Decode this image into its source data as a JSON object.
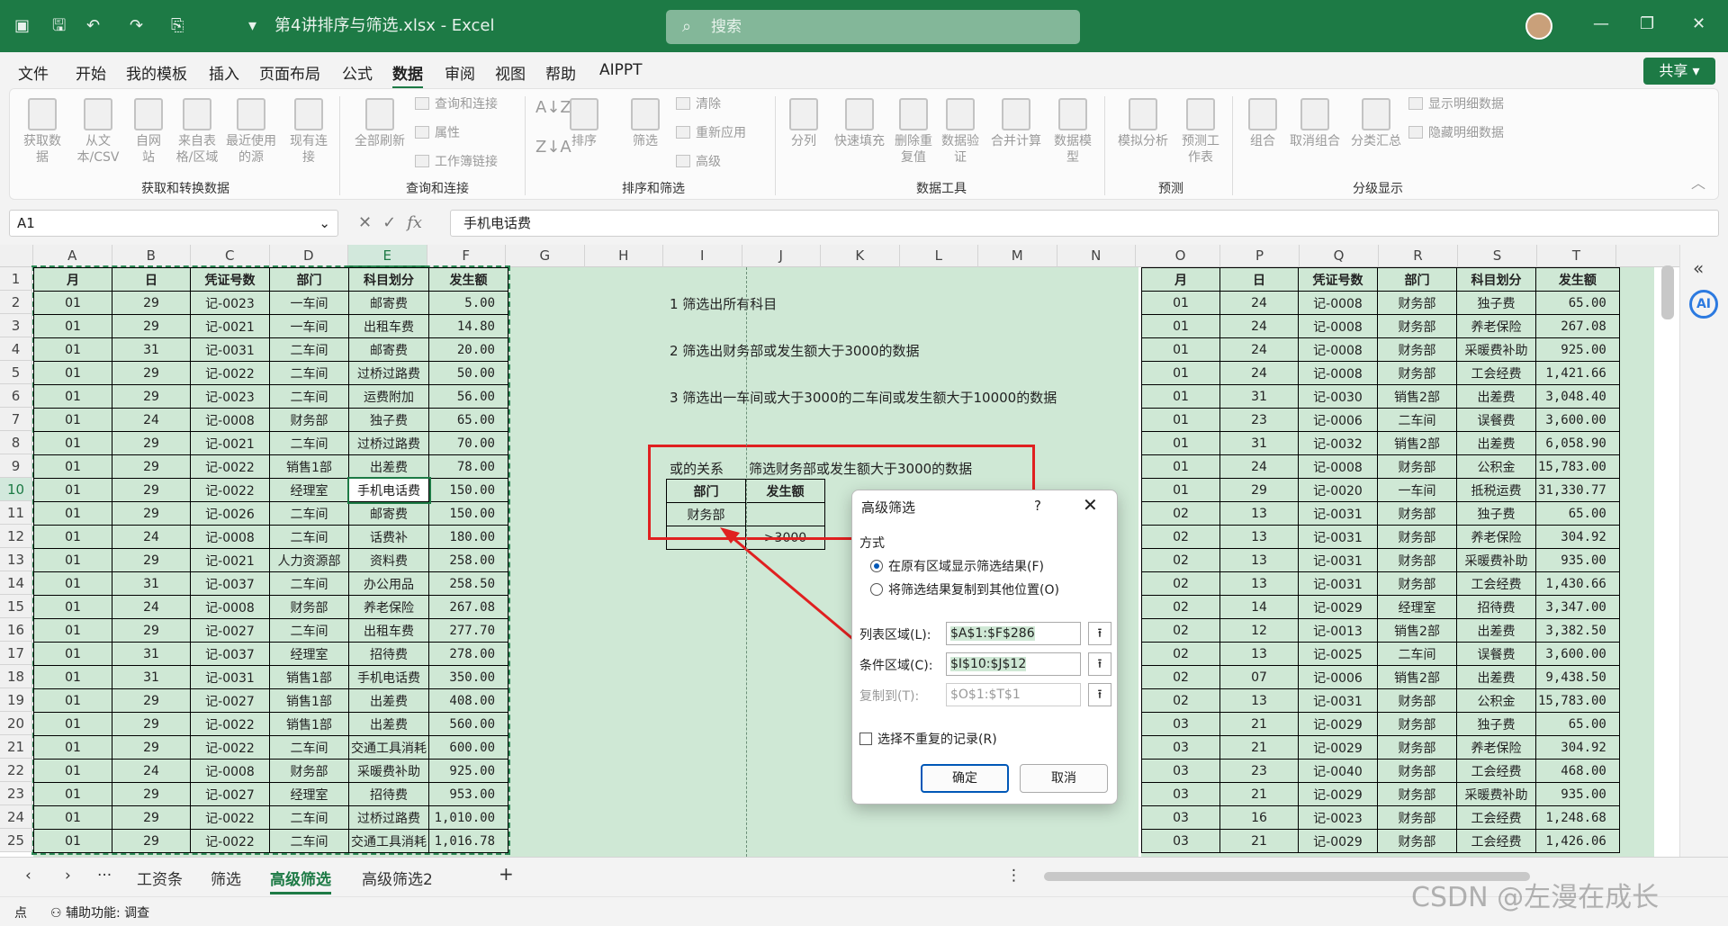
{
  "titlebar": {
    "filename": "第4讲排序与筛选.xlsx - Excel",
    "search_placeholder": "搜索"
  },
  "menu": [
    "文件",
    "开始",
    "我的模板",
    "插入",
    "页面布局",
    "公式",
    "数据",
    "审阅",
    "视图",
    "帮助",
    "AIPPT"
  ],
  "active_menu": "数据",
  "share_label": "共享",
  "ribbon": {
    "get_data": [
      "获取数据",
      "从文本/CSV",
      "自网站",
      "来自表格/区域",
      "最近使用的源",
      "现有连接"
    ],
    "query_main": "全部刷新",
    "query_small": [
      "查询和连接",
      "属性",
      "工作簿链接"
    ],
    "sort": [
      "排序"
    ],
    "filter": "筛选",
    "filter_small": [
      "清除",
      "重新应用",
      "高级"
    ],
    "tools": [
      "分列",
      "快速填充",
      "删除重复值",
      "数据验证",
      "合并计算",
      "数据模型"
    ],
    "forecast": [
      "模拟分析",
      "预测工作表"
    ],
    "outline": [
      "组合",
      "取消组合",
      "分类汇总"
    ],
    "outline_small": [
      "显示明细数据",
      "隐藏明细数据"
    ],
    "groups": [
      "获取和转换数据",
      "查询和连接",
      "排序和筛选",
      "数据工具",
      "预测",
      "分级显示"
    ]
  },
  "formula_bar": {
    "cell_ref": "A1",
    "fx": "fx",
    "value": "手机电话费"
  },
  "columns": [
    "A",
    "B",
    "C",
    "D",
    "E",
    "F",
    "G",
    "H",
    "I",
    "J",
    "K",
    "L",
    "M",
    "N",
    "O",
    "P",
    "Q",
    "R",
    "S",
    "T"
  ],
  "rows": [
    "1",
    "2",
    "3",
    "4",
    "5",
    "6",
    "7",
    "8",
    "9",
    "10",
    "11",
    "12",
    "13",
    "14",
    "15",
    "16",
    "17",
    "18",
    "19",
    "20",
    "21",
    "22",
    "23",
    "24",
    "25"
  ],
  "left_header": [
    "月",
    "日",
    "凭证号数",
    "部门",
    "科目划分",
    "发生额"
  ],
  "left_rows": [
    [
      "01",
      "29",
      "记-0023",
      "一车间",
      "邮寄费",
      "5.00"
    ],
    [
      "01",
      "29",
      "记-0021",
      "一车间",
      "出租车费",
      "14.80"
    ],
    [
      "01",
      "31",
      "记-0031",
      "二车间",
      "邮寄费",
      "20.00"
    ],
    [
      "01",
      "29",
      "记-0022",
      "二车间",
      "过桥过路费",
      "50.00"
    ],
    [
      "01",
      "29",
      "记-0023",
      "二车间",
      "运费附加",
      "56.00"
    ],
    [
      "01",
      "24",
      "记-0008",
      "财务部",
      "独子费",
      "65.00"
    ],
    [
      "01",
      "29",
      "记-0021",
      "二车间",
      "过桥过路费",
      "70.00"
    ],
    [
      "01",
      "29",
      "记-0022",
      "销售1部",
      "出差费",
      "78.00"
    ],
    [
      "01",
      "29",
      "记-0022",
      "经理室",
      "手机电话费",
      "150.00"
    ],
    [
      "01",
      "29",
      "记-0026",
      "二车间",
      "邮寄费",
      "150.00"
    ],
    [
      "01",
      "24",
      "记-0008",
      "二车间",
      "话费补",
      "180.00"
    ],
    [
      "01",
      "29",
      "记-0021",
      "人力资源部",
      "资料费",
      "258.00"
    ],
    [
      "01",
      "31",
      "记-0037",
      "二车间",
      "办公用品",
      "258.50"
    ],
    [
      "01",
      "24",
      "记-0008",
      "财务部",
      "养老保险",
      "267.08"
    ],
    [
      "01",
      "29",
      "记-0027",
      "二车间",
      "出租车费",
      "277.70"
    ],
    [
      "01",
      "31",
      "记-0037",
      "经理室",
      "招待费",
      "278.00"
    ],
    [
      "01",
      "31",
      "记-0031",
      "销售1部",
      "手机电话费",
      "350.00"
    ],
    [
      "01",
      "29",
      "记-0027",
      "销售1部",
      "出差费",
      "408.00"
    ],
    [
      "01",
      "29",
      "记-0022",
      "销售1部",
      "出差费",
      "560.00"
    ],
    [
      "01",
      "29",
      "记-0022",
      "二车间",
      "交通工具消耗",
      "600.00"
    ],
    [
      "01",
      "24",
      "记-0008",
      "财务部",
      "采暖费补助",
      "925.00"
    ],
    [
      "01",
      "29",
      "记-0027",
      "经理室",
      "招待费",
      "953.00"
    ],
    [
      "01",
      "29",
      "记-0022",
      "二车间",
      "过桥过路费",
      "1,010.00"
    ],
    [
      "01",
      "29",
      "记-0022",
      "二车间",
      "交通工具消耗",
      "1,016.78"
    ]
  ],
  "right_header": [
    "月",
    "日",
    "凭证号数",
    "部门",
    "科目划分",
    "发生额"
  ],
  "right_rows": [
    [
      "01",
      "24",
      "记-0008",
      "财务部",
      "独子费",
      "65.00"
    ],
    [
      "01",
      "24",
      "记-0008",
      "财务部",
      "养老保险",
      "267.08"
    ],
    [
      "01",
      "24",
      "记-0008",
      "财务部",
      "采暖费补助",
      "925.00"
    ],
    [
      "01",
      "24",
      "记-0008",
      "财务部",
      "工会经费",
      "1,421.66"
    ],
    [
      "01",
      "31",
      "记-0030",
      "销售2部",
      "出差费",
      "3,048.40"
    ],
    [
      "01",
      "23",
      "记-0006",
      "二车间",
      "误餐费",
      "3,600.00"
    ],
    [
      "01",
      "31",
      "记-0032",
      "销售2部",
      "出差费",
      "6,058.90"
    ],
    [
      "01",
      "24",
      "记-0008",
      "财务部",
      "公积金",
      "15,783.00"
    ],
    [
      "01",
      "29",
      "记-0020",
      "一车间",
      "抵税运费",
      "31,330.77"
    ],
    [
      "02",
      "13",
      "记-0031",
      "财务部",
      "独子费",
      "65.00"
    ],
    [
      "02",
      "13",
      "记-0031",
      "财务部",
      "养老保险",
      "304.92"
    ],
    [
      "02",
      "13",
      "记-0031",
      "财务部",
      "采暖费补助",
      "935.00"
    ],
    [
      "02",
      "13",
      "记-0031",
      "财务部",
      "工会经费",
      "1,430.66"
    ],
    [
      "02",
      "14",
      "记-0029",
      "经理室",
      "招待费",
      "3,347.00"
    ],
    [
      "02",
      "12",
      "记-0013",
      "销售2部",
      "出差费",
      "3,382.50"
    ],
    [
      "02",
      "13",
      "记-0025",
      "二车间",
      "误餐费",
      "3,600.00"
    ],
    [
      "02",
      "07",
      "记-0006",
      "销售2部",
      "出差费",
      "9,438.50"
    ],
    [
      "02",
      "13",
      "记-0031",
      "财务部",
      "公积金",
      "15,783.00"
    ],
    [
      "03",
      "21",
      "记-0029",
      "财务部",
      "独子费",
      "65.00"
    ],
    [
      "03",
      "21",
      "记-0029",
      "财务部",
      "养老保险",
      "304.92"
    ],
    [
      "03",
      "23",
      "记-0040",
      "财务部",
      "工会经费",
      "468.00"
    ],
    [
      "03",
      "21",
      "记-0029",
      "财务部",
      "采暖费补助",
      "935.00"
    ],
    [
      "03",
      "16",
      "记-0023",
      "财务部",
      "工会经费",
      "1,248.68"
    ],
    [
      "03",
      "21",
      "记-0029",
      "财务部",
      "工会经费",
      "1,426.06"
    ]
  ],
  "notes": [
    "1 筛选出所有科目",
    "2 筛选出财务部或发生额大于3000的数据",
    "3 筛选出一车间或大于3000的二车间或发生额大于10000的数据"
  ],
  "or_label": "或的关系",
  "or_desc": "筛选财务部或发生额大于3000的数据",
  "criteria": {
    "h1": "部门",
    "h2": "发生额",
    "v1": "财务部",
    "v2": ">3000"
  },
  "dialog": {
    "title": "高级筛选",
    "help": "?",
    "close": "✕",
    "section": "方式",
    "radio1": "在原有区域显示筛选结果(F)",
    "radio2": "将筛选结果复制到其他位置(O)",
    "list_label": "列表区域(L):",
    "list_value": "$A$1:$F$286",
    "crit_label": "条件区域(C):",
    "crit_value": "$I$10:$J$12",
    "copy_label": "复制到(T):",
    "copy_value": "$O$1:$T$1",
    "unique_label": "选择不重复的记录(R)",
    "ok": "确定",
    "cancel": "取消"
  },
  "sheets": [
    "工资条",
    "筛选",
    "高级筛选",
    "高级筛选2"
  ],
  "active_sheet": "高级筛选",
  "status": {
    "mode": "点",
    "accessibility": "辅助功能: 调查"
  },
  "watermark": "CSDN @左漫在成长",
  "colors": {
    "accent": "#1d7a45",
    "cell_fill": "#cfe8d5",
    "red_box": "#e02020"
  }
}
